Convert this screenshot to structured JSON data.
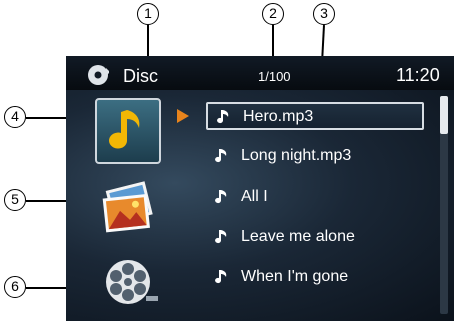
{
  "callouts": {
    "c1": "1",
    "c2": "2",
    "c3": "3",
    "c4": "4",
    "c5": "5",
    "c6": "6"
  },
  "header": {
    "source_label": "Disc",
    "track_counter": "1/100",
    "clock": "11:20"
  },
  "modes": {
    "audio": "music-note-icon",
    "photo": "photo-icon",
    "video": "film-reel-icon"
  },
  "files": [
    {
      "name": "Hero.mp3",
      "selected": true
    },
    {
      "name": "Long night.mp3",
      "selected": false
    },
    {
      "name": "All I",
      "selected": false
    },
    {
      "name": "Leave me alone",
      "selected": false
    },
    {
      "name": "When I'm gone",
      "selected": false
    }
  ],
  "colors": {
    "accent": "#e8841c",
    "note": "#f2b705",
    "screen_bg": "#1a2736"
  },
  "scroll": {
    "visible_fraction": 0.17
  }
}
